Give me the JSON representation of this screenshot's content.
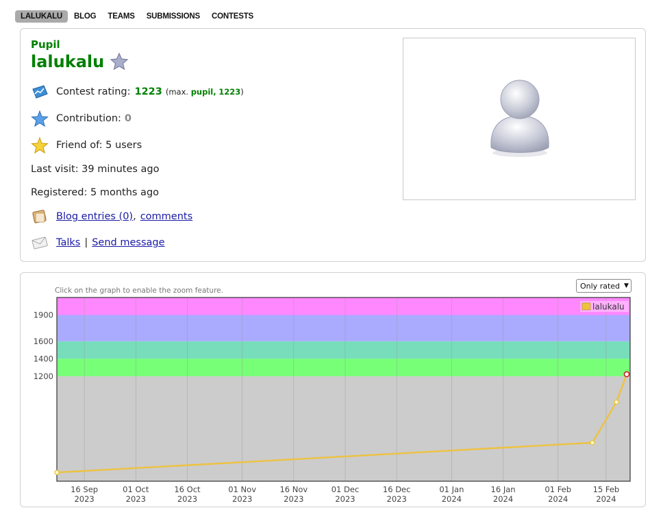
{
  "nav": {
    "items": [
      {
        "label": "LALUKALU",
        "active": true
      },
      {
        "label": "BLOG",
        "active": false
      },
      {
        "label": "TEAMS",
        "active": false
      },
      {
        "label": "SUBMISSIONS",
        "active": false
      },
      {
        "label": "CONTESTS",
        "active": false
      }
    ]
  },
  "profile": {
    "rank": "Pupil",
    "handle": "lalukalu",
    "rating_label": "Contest rating:",
    "rating_value": "1223",
    "rating_max_prefix": "(max.",
    "rating_max_rank": "pupil,",
    "rating_max_value": "1223",
    "rating_max_suffix": ")",
    "contribution_label": "Contribution:",
    "contribution_value": "0",
    "friend_label": "Friend of: 5 users",
    "last_visit": "Last visit: 39 minutes ago",
    "registered": "Registered: 5 months ago",
    "blog_link": "Blog entries (0)",
    "comma": ",",
    "comments_link": "comments",
    "talks_link": "Talks",
    "separator": "|",
    "send_message_link": "Send message"
  },
  "colors": {
    "rank_green": "#008000",
    "link_blue": "#1a1aa6",
    "line_gold": "#edc240"
  },
  "chart_hint": "Click on the graph to enable the zoom feature.",
  "filter": {
    "selected": "Only rated"
  },
  "chart_data": {
    "type": "line",
    "title": "",
    "xlabel": "",
    "ylabel": "",
    "ylim": [
      0,
      2100
    ],
    "xlim": [
      "2023-09-08",
      "2024-02-22"
    ],
    "y_ticks": [
      1200,
      1400,
      1600,
      1900
    ],
    "x_ticks": [
      {
        "date": "2023-09-16",
        "label": [
          "16 Sep",
          "2023"
        ]
      },
      {
        "date": "2023-10-01",
        "label": [
          "01 Oct",
          "2023"
        ]
      },
      {
        "date": "2023-10-16",
        "label": [
          "16 Oct",
          "2023"
        ]
      },
      {
        "date": "2023-11-01",
        "label": [
          "01 Nov",
          "2023"
        ]
      },
      {
        "date": "2023-11-16",
        "label": [
          "16 Nov",
          "2023"
        ]
      },
      {
        "date": "2023-12-01",
        "label": [
          "01 Dec",
          "2023"
        ]
      },
      {
        "date": "2023-12-16",
        "label": [
          "16 Dec",
          "2023"
        ]
      },
      {
        "date": "2024-01-01",
        "label": [
          "01 Jan",
          "2024"
        ]
      },
      {
        "date": "2024-01-16",
        "label": [
          "16 Jan",
          "2024"
        ]
      },
      {
        "date": "2024-02-01",
        "label": [
          "01 Feb",
          "2024"
        ]
      },
      {
        "date": "2024-02-15",
        "label": [
          "15 Feb",
          "2024"
        ]
      }
    ],
    "bands": [
      {
        "from": 0,
        "to": 1200,
        "color": "#cccccc"
      },
      {
        "from": 1200,
        "to": 1400,
        "color": "#77ff77"
      },
      {
        "from": 1400,
        "to": 1600,
        "color": "#77ddbb"
      },
      {
        "from": 1600,
        "to": 1900,
        "color": "#aaaaff"
      },
      {
        "from": 1900,
        "to": 2100,
        "color": "#ff88ff"
      }
    ],
    "series": [
      {
        "name": "lalukalu",
        "color": "#edc240",
        "points": [
          {
            "x": "2023-09-08",
            "y": 100
          },
          {
            "x": "2024-02-11",
            "y": 440
          },
          {
            "x": "2024-02-18",
            "y": 905
          },
          {
            "x": "2024-02-21",
            "y": 1223,
            "highlight": true
          }
        ]
      }
    ],
    "legend": {
      "position": "top-right"
    },
    "grid": true
  }
}
